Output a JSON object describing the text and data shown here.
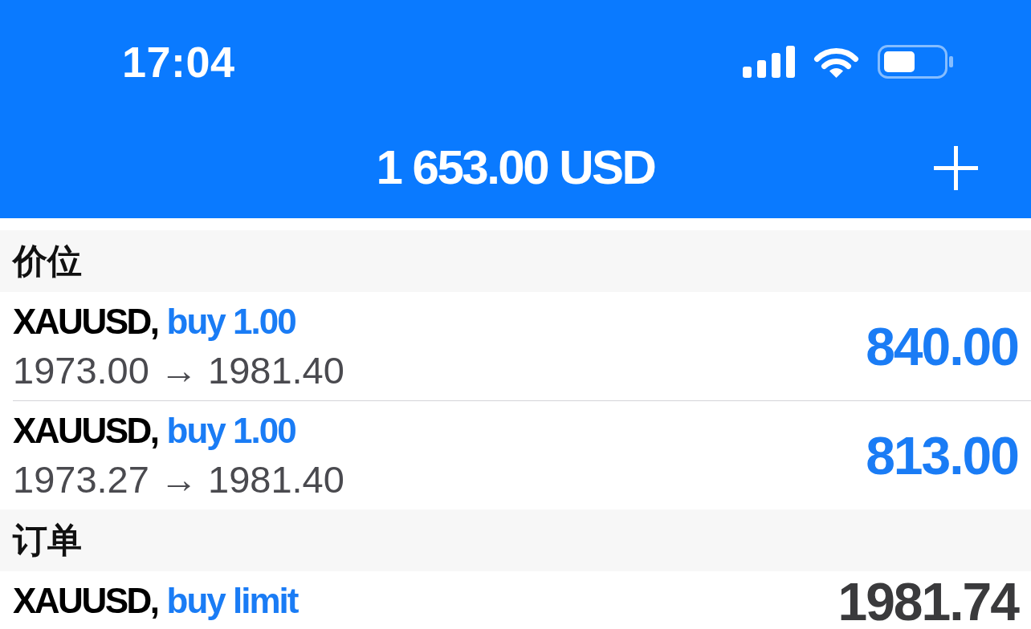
{
  "status_bar": {
    "time": "17:04"
  },
  "header": {
    "title": "1 653.00 USD"
  },
  "sections": [
    {
      "title": "价位",
      "items": [
        {
          "kind": "position",
          "symbol": "XAUUSD,",
          "action": "buy 1.00",
          "prices": "1973.00 → 1981.40",
          "value": "840.00"
        },
        {
          "kind": "position",
          "symbol": "XAUUSD,",
          "action": "buy 1.00",
          "prices": "1973.27 → 1981.40",
          "value": "813.00"
        }
      ]
    },
    {
      "title": "订单",
      "items": [
        {
          "kind": "order",
          "symbol": "XAUUSD,",
          "action": "buy limit",
          "value": "1981.74"
        }
      ]
    }
  ]
}
